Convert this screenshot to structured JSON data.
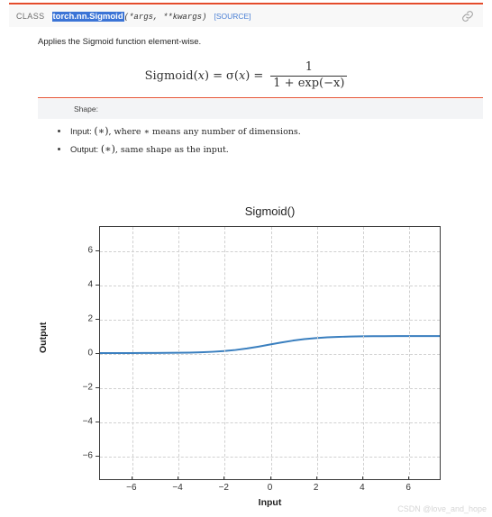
{
  "theme": {
    "accent_rule": "#e44c2c",
    "selection_highlight": "#3b74d6",
    "link_color": "#4a7fd4",
    "curve_color": "#3a7fbf",
    "banner_bg": "#f3f4f6"
  },
  "header": {
    "keyword": "CLASS",
    "qualified_name": "torch.nn.Sigmoid",
    "params": "(*args, **kwargs)",
    "source_link": "[SOURCE]",
    "anchor_icon": "link-chain-icon"
  },
  "body": {
    "description": "Applies the Sigmoid function element-wise.",
    "formula": {
      "lhs": "Sigmoid(",
      "lhs_var": "x",
      "lhs_close": ")",
      "eq1": "=",
      "sigma": "σ(",
      "sigma_var": "x",
      "sigma_close": ")",
      "eq2": "=",
      "numerator": "1",
      "denominator": "1 + exp(−x)",
      "plain_text": "Sigmoid(x) = σ(x) = 1 / (1 + exp(−x))"
    },
    "shape_section": {
      "title": "Shape:",
      "items": [
        {
          "prefix": "Input: ",
          "symbol": "(∗)",
          "suffix": ", where ∗ means any number of dimensions."
        },
        {
          "prefix": "Output: ",
          "symbol": "(∗)",
          "suffix": ", same shape as the input."
        }
      ]
    }
  },
  "chart_data": {
    "type": "line",
    "title": "Sigmoid()",
    "xlabel": "Input",
    "ylabel": "Output",
    "xlim": [
      -7.4,
      7.4
    ],
    "ylim": [
      -7.4,
      7.4
    ],
    "grid": true,
    "legend": null,
    "xticks": [
      -6,
      -4,
      -2,
      0,
      2,
      4,
      6
    ],
    "xtick_labels": [
      "−6",
      "−4",
      "−2",
      "0",
      "2",
      "4",
      "6"
    ],
    "yticks": [
      6,
      4,
      2,
      0,
      -2,
      -4,
      -6
    ],
    "ytick_labels": [
      "6",
      "4",
      "2",
      "0",
      "−2",
      "−4",
      "−6"
    ],
    "series": [
      {
        "name": "sigmoid",
        "color": "#3a7fbf",
        "linewidth": 2,
        "x": [
          -7.4,
          -7.0,
          -6.5,
          -6.0,
          -5.5,
          -5.0,
          -4.5,
          -4.0,
          -3.5,
          -3.0,
          -2.5,
          -2.0,
          -1.5,
          -1.0,
          -0.5,
          0.0,
          0.5,
          1.0,
          1.5,
          2.0,
          2.5,
          3.0,
          3.5,
          4.0,
          4.5,
          5.0,
          5.5,
          6.0,
          6.5,
          7.0,
          7.4
        ],
        "y": [
          0.0006,
          0.0009,
          0.0015,
          0.0025,
          0.0041,
          0.0067,
          0.011,
          0.018,
          0.029,
          0.047,
          0.076,
          0.119,
          0.182,
          0.269,
          0.378,
          0.5,
          0.622,
          0.731,
          0.818,
          0.881,
          0.924,
          0.953,
          0.971,
          0.982,
          0.989,
          0.993,
          0.996,
          0.998,
          0.9985,
          0.9991,
          0.9994
        ]
      }
    ]
  },
  "watermark": {
    "text": "CSDN @love_and_hope"
  }
}
